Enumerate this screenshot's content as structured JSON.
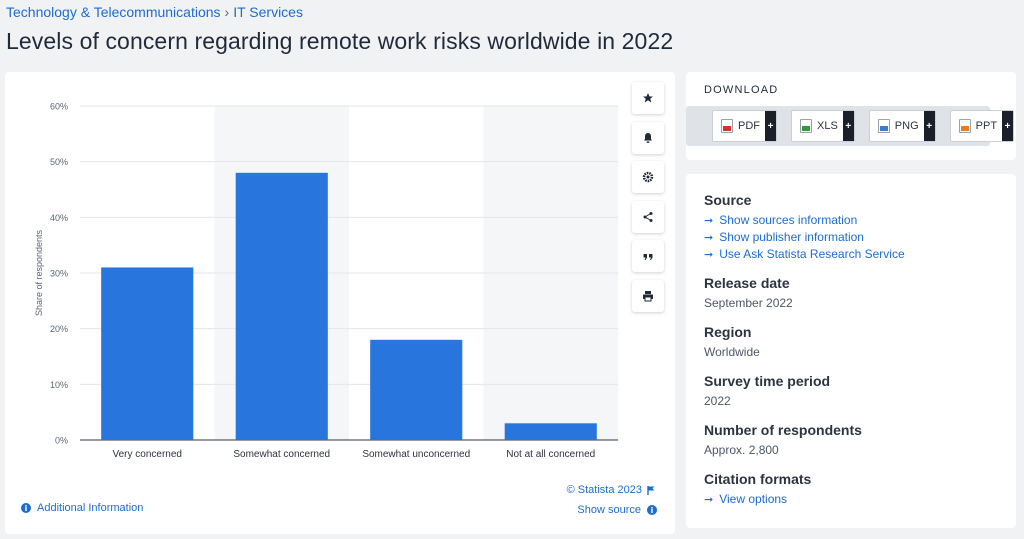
{
  "breadcrumb": {
    "category": "Technology & Telecommunications",
    "separator": "›",
    "subcategory": "IT Services"
  },
  "title": "Levels of concern regarding remote work risks worldwide in 2022",
  "toolbar": {
    "icons": [
      "star-icon",
      "bell-icon",
      "gear-icon",
      "share-icon",
      "quote-icon",
      "print-icon"
    ]
  },
  "chart_data": {
    "type": "bar",
    "categories": [
      "Very concerned",
      "Somewhat concerned",
      "Somewhat unconcerned",
      "Not at all concerned"
    ],
    "values": [
      31,
      48,
      18,
      3
    ],
    "ylabel": "Share of respondents",
    "xlabel": "",
    "ylim": [
      0,
      60
    ],
    "yticks": [
      "0%",
      "10%",
      "20%",
      "30%",
      "40%",
      "50%",
      "60%"
    ],
    "bar_color": "#2876dd",
    "alternate_band_color": "#f5f6f8",
    "grid": true
  },
  "footer": {
    "copyright": "© Statista 2023",
    "additional_info": "Additional Information",
    "show_source": "Show source"
  },
  "download": {
    "title": "DOWNLOAD",
    "formats": [
      {
        "label": "PDF",
        "icon": "pdf-file-icon"
      },
      {
        "label": "XLS",
        "icon": "xls-file-icon"
      },
      {
        "label": "PNG",
        "icon": "png-file-icon"
      },
      {
        "label": "PPT",
        "icon": "ppt-file-icon"
      }
    ],
    "plus": "+"
  },
  "meta": {
    "source_heading": "Source",
    "source_links": [
      "Show sources information",
      "Show publisher information",
      "Use Ask Statista Research Service"
    ],
    "release_heading": "Release date",
    "release_value": "September 2022",
    "region_heading": "Region",
    "region_value": "Worldwide",
    "period_heading": "Survey time period",
    "period_value": "2022",
    "respondents_heading": "Number of respondents",
    "respondents_value": "Approx. 2,800",
    "citation_heading": "Citation formats",
    "citation_link": "View options"
  },
  "colors": {
    "accent": "#1c6cd1",
    "bar": "#2876dd",
    "background": "#f1f2f4"
  }
}
